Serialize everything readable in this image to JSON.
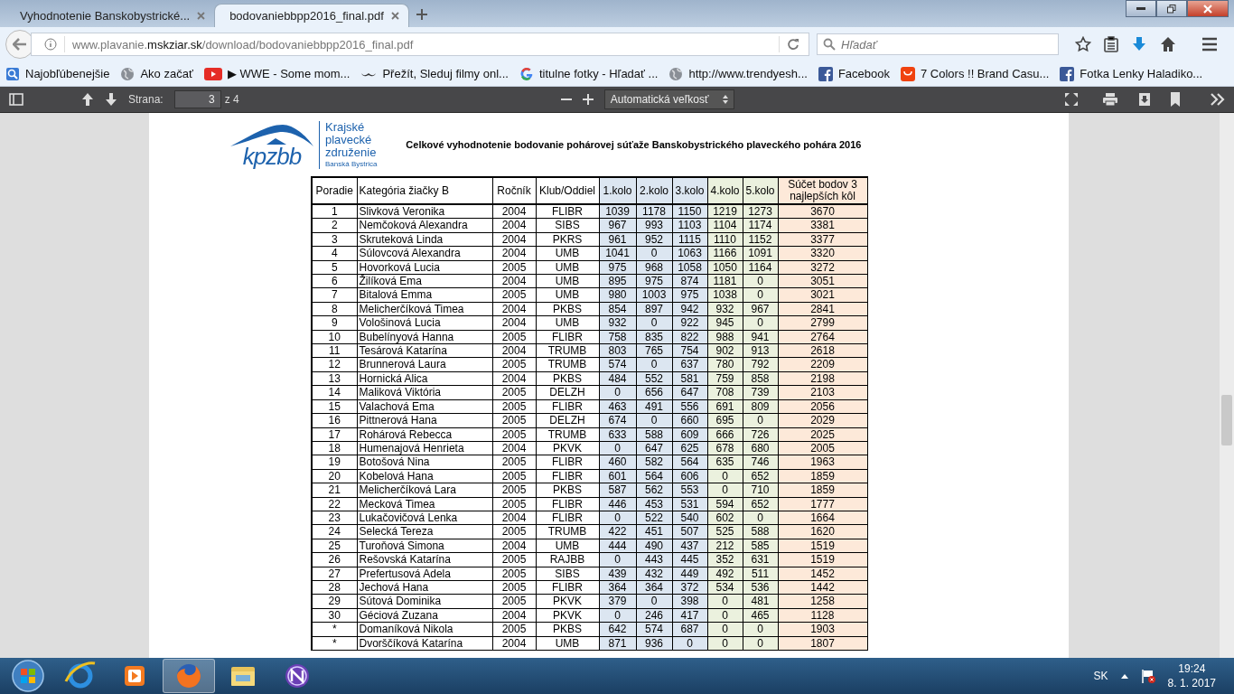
{
  "browser_tabs": [
    {
      "title": "Vyhodnotenie Banskobystrické...",
      "selected": false
    },
    {
      "title": "bodovaniebbpp2016_final.pdf",
      "selected": true
    }
  ],
  "address_bar": {
    "url": "www.plavanie.**mskziar.sk**/download/bodovaniebbpp2016_final.pdf"
  },
  "search": {
    "placeholder": "Hľadať"
  },
  "bookmarks": [
    {
      "kind": "library",
      "label": "Najobľúbenejšie"
    },
    {
      "kind": "globe",
      "label": "Ako začať"
    },
    {
      "kind": "video",
      "label": "▶ WWE - Some mom..."
    },
    {
      "kind": "mustache",
      "label": "Přežít, Sleduj filmy onl..."
    },
    {
      "kind": "google",
      "label": "titulne fotky - Hľadať ..."
    },
    {
      "kind": "globe",
      "label": "http://www.trendyesh..."
    },
    {
      "kind": "facebook",
      "label": "Facebook"
    },
    {
      "kind": "shop",
      "label": "7 Colors !! Brand Casu..."
    },
    {
      "kind": "facebook",
      "label": "Fotka Lenky Haladiko..."
    }
  ],
  "pdf_toolbar": {
    "page_label": "Strana:",
    "page": "3",
    "page_total": "z 4",
    "zoom": "Automatická veľkosť"
  },
  "document": {
    "logo": {
      "mark": "kpzbb",
      "lines": [
        "Krajské",
        "plavecké",
        "združenie"
      ],
      "subtitle": "Banská Bystrica"
    },
    "title": "Celkové vyhodnotenie bodovanie pohárovej súťaže Banskobystrického plaveckého pohára 2016",
    "table": {
      "columns": [
        {
          "label": "Poradie",
          "color": "#ffffff"
        },
        {
          "label": "Kategória žiačky B",
          "color": "#ffffff"
        },
        {
          "label": "Ročník",
          "color": "#ffffff"
        },
        {
          "label": "Klub/Oddiel",
          "color": "#ffffff"
        },
        {
          "label": "1.kolo",
          "color": "#dce6f1"
        },
        {
          "label": "2.kolo",
          "color": "#dce6f1"
        },
        {
          "label": "3.kolo",
          "color": "#dce6f1"
        },
        {
          "label": "4.kolo",
          "color": "#ebf1de"
        },
        {
          "label": "5.kolo",
          "color": "#ebf1de"
        },
        {
          "label": "Súčet bodov 3 najlepších kôl",
          "color": "#fde9d9"
        }
      ],
      "rows": [
        [
          "1",
          "Slivková Veronika",
          "2004",
          "FLIBR",
          "1039",
          "1178",
          "1150",
          "1219",
          "1273",
          "3670"
        ],
        [
          "2",
          "Nemčoková Alexandra",
          "2004",
          "SIBS",
          "967",
          "993",
          "1103",
          "1104",
          "1174",
          "3381"
        ],
        [
          "3",
          "Skruteková Linda",
          "2004",
          "PKRS",
          "961",
          "952",
          "1115",
          "1110",
          "1152",
          "3377"
        ],
        [
          "4",
          "Súlovcová Alexandra",
          "2004",
          "UMB",
          "1041",
          "0",
          "1063",
          "1166",
          "1091",
          "3320"
        ],
        [
          "5",
          "Hovorková Lucia",
          "2005",
          "UMB",
          "975",
          "968",
          "1058",
          "1050",
          "1164",
          "3272"
        ],
        [
          "6",
          "Žilíková Ema",
          "2004",
          "UMB",
          "895",
          "975",
          "874",
          "1181",
          "0",
          "3051"
        ],
        [
          "7",
          "Bitalová Emma",
          "2005",
          "UMB",
          "980",
          "1003",
          "975",
          "1038",
          "0",
          "3021"
        ],
        [
          "8",
          "Melicherčíková Timea",
          "2004",
          "PKBS",
          "854",
          "897",
          "942",
          "932",
          "967",
          "2841"
        ],
        [
          "9",
          "Vološinová Lucia",
          "2004",
          "UMB",
          "932",
          "0",
          "922",
          "945",
          "0",
          "2799"
        ],
        [
          "10",
          "Bubelínyová Hanna",
          "2005",
          "FLIBR",
          "758",
          "835",
          "822",
          "988",
          "941",
          "2764"
        ],
        [
          "11",
          "Tesárová Katarína",
          "2004",
          "TRUMB",
          "803",
          "765",
          "754",
          "902",
          "913",
          "2618"
        ],
        [
          "12",
          "Brunnerová Laura",
          "2005",
          "TRUMB",
          "574",
          "0",
          "637",
          "780",
          "792",
          "2209"
        ],
        [
          "13",
          "Hornická Alica",
          "2004",
          "PKBS",
          "484",
          "552",
          "581",
          "759",
          "858",
          "2198"
        ],
        [
          "14",
          "Maliková Viktória",
          "2005",
          "DELZH",
          "0",
          "656",
          "647",
          "708",
          "739",
          "2103"
        ],
        [
          "15",
          "Valachová Ema",
          "2005",
          "FLIBR",
          "463",
          "491",
          "556",
          "691",
          "809",
          "2056"
        ],
        [
          "16",
          "Pittnerová Hana",
          "2005",
          "DELZH",
          "674",
          "0",
          "660",
          "695",
          "0",
          "2029"
        ],
        [
          "17",
          "Rohárová Rebecca",
          "2005",
          "TRUMB",
          "633",
          "588",
          "609",
          "666",
          "726",
          "2025"
        ],
        [
          "18",
          "Humenajová Henrieta",
          "2004",
          "PKVK",
          "0",
          "647",
          "625",
          "678",
          "680",
          "2005"
        ],
        [
          "19",
          "Botošová Nina",
          "2005",
          "FLIBR",
          "460",
          "582",
          "564",
          "635",
          "746",
          "1963"
        ],
        [
          "20",
          "Kobelová Hana",
          "2005",
          "FLIBR",
          "601",
          "564",
          "606",
          "0",
          "652",
          "1859"
        ],
        [
          "21",
          "Melicherčíková Lara",
          "2005",
          "PKBS",
          "587",
          "562",
          "553",
          "0",
          "710",
          "1859"
        ],
        [
          "22",
          "Mecková Timea",
          "2005",
          "FLIBR",
          "446",
          "453",
          "531",
          "594",
          "652",
          "1777"
        ],
        [
          "23",
          "Lukačovičová Lenka",
          "2004",
          "FLIBR",
          "0",
          "522",
          "540",
          "602",
          "0",
          "1664"
        ],
        [
          "24",
          "Selecká Tereza",
          "2005",
          "TRUMB",
          "422",
          "451",
          "507",
          "525",
          "588",
          "1620"
        ],
        [
          "25",
          "Turoňová Simona",
          "2004",
          "UMB",
          "444",
          "490",
          "437",
          "212",
          "585",
          "1519"
        ],
        [
          "26",
          "Rešovská Katarína",
          "2005",
          "RAJBB",
          "0",
          "443",
          "445",
          "352",
          "631",
          "1519"
        ],
        [
          "27",
          "Prefertusová Adela",
          "2005",
          "SIBS",
          "439",
          "432",
          "449",
          "492",
          "511",
          "1452"
        ],
        [
          "28",
          "Jechová Hana",
          "2005",
          "FLIBR",
          "364",
          "364",
          "372",
          "534",
          "536",
          "1442"
        ],
        [
          "29",
          "Sútová Dominika",
          "2005",
          "PKVK",
          "379",
          "0",
          "398",
          "0",
          "481",
          "1258"
        ],
        [
          "30",
          "Géciová Zuzana",
          "2004",
          "PKVK",
          "0",
          "246",
          "417",
          "0",
          "465",
          "1128"
        ],
        [
          "*",
          "Domaníková Nikola",
          "2005",
          "PKBS",
          "642",
          "574",
          "687",
          "0",
          "0",
          "1903"
        ],
        [
          "*",
          "Dvorščíková Katarína",
          "2004",
          "UMB",
          "871",
          "936",
          "0",
          "0",
          "0",
          "1807"
        ]
      ]
    }
  },
  "taskbar": {
    "apps": [
      {
        "kind": "ie",
        "selected": false
      },
      {
        "kind": "media",
        "selected": false
      },
      {
        "kind": "firefox",
        "selected": true
      },
      {
        "kind": "explorer",
        "selected": false
      },
      {
        "kind": "nvu",
        "selected": false
      }
    ],
    "language": "SK",
    "time": "19:24",
    "date": "8. 1. 2017"
  }
}
